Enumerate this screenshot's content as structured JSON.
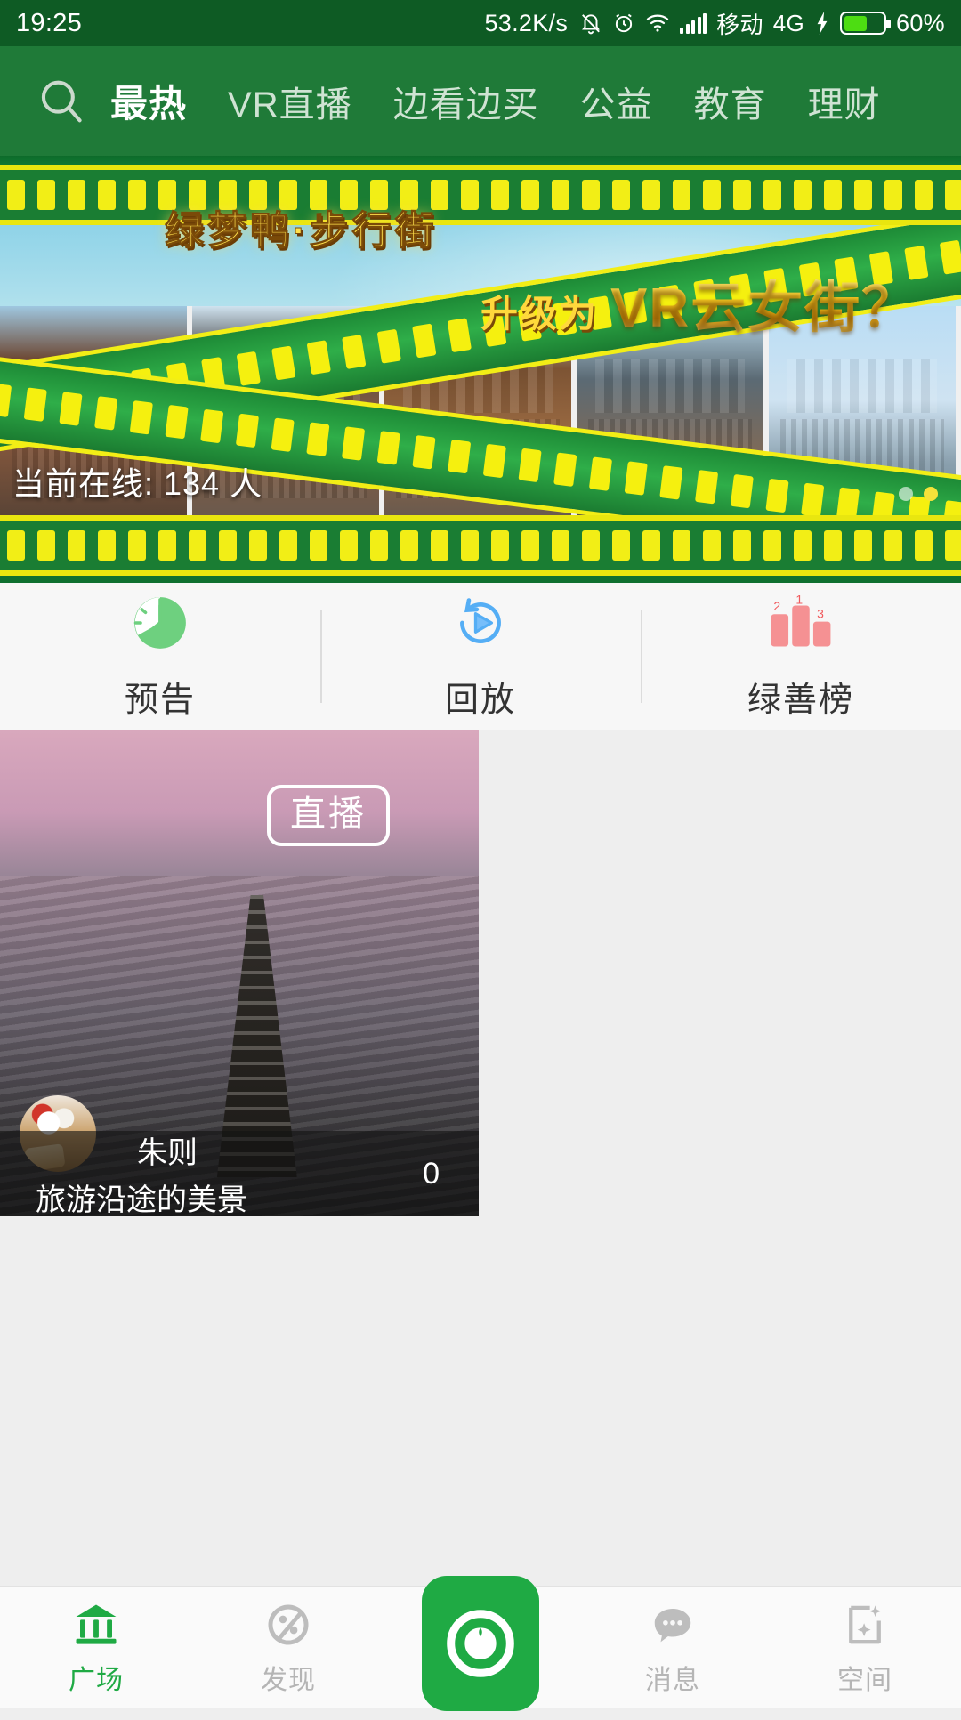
{
  "status_bar": {
    "time": "19:25",
    "net_speed": "53.2K/s",
    "carrier": "移动",
    "network": "4G",
    "battery_percent": "60%",
    "battery_level": 60,
    "icons": [
      "bell-muted-icon",
      "alarm-icon",
      "wifi-icon",
      "signal-icon",
      "charging-bolt-icon",
      "battery-icon"
    ],
    "bg_color": "#0e5b24"
  },
  "top_nav": {
    "search_icon": "search-icon",
    "bg_color": "#1f7a38",
    "active_tab": "最热",
    "tabs": [
      {
        "label": "最热",
        "active": true
      },
      {
        "label": "VR直播",
        "active": false
      },
      {
        "label": "边看边买",
        "active": false
      },
      {
        "label": "公益",
        "active": false
      },
      {
        "label": "教育",
        "active": false
      },
      {
        "label": "理财",
        "active": false
      }
    ]
  },
  "banner": {
    "title": "绿梦鸭·步行街",
    "subtitle_prefix": "升级为",
    "subtitle_main": "VR云女街？",
    "online_label": "当前在线: 134 人",
    "online_count": "134",
    "dots": [
      {
        "active": false
      },
      {
        "active": true
      }
    ],
    "accent_yellow": "#f2ee16",
    "accent_green": "#1a7d33"
  },
  "quick_actions": [
    {
      "label": "预告",
      "icon": "clock-icon",
      "color": "#6ed07f"
    },
    {
      "label": "回放",
      "icon": "replay-icon",
      "color": "#55aef5"
    },
    {
      "label": "绿善榜",
      "icon": "podium-rank-icon",
      "color": "#f59193",
      "ranks": [
        "2",
        "1",
        "3"
      ]
    }
  ],
  "live_cards": [
    {
      "badge": "直播",
      "username": "朱则",
      "title": "旅游沿途的美景",
      "viewer_count": "0",
      "avatar": "user-avatar"
    }
  ],
  "bottom_nav": {
    "active": "广场",
    "accent_color": "#1faa44",
    "items": [
      {
        "label": "广场",
        "icon": "plaza-icon",
        "active": true
      },
      {
        "label": "发现",
        "icon": "discover-icon",
        "active": false
      },
      {
        "label": "",
        "icon": "camera-eye-button",
        "active": false,
        "is_center": true
      },
      {
        "label": "消息",
        "icon": "message-icon",
        "active": false
      },
      {
        "label": "空间",
        "icon": "space-icon",
        "active": false
      }
    ]
  }
}
